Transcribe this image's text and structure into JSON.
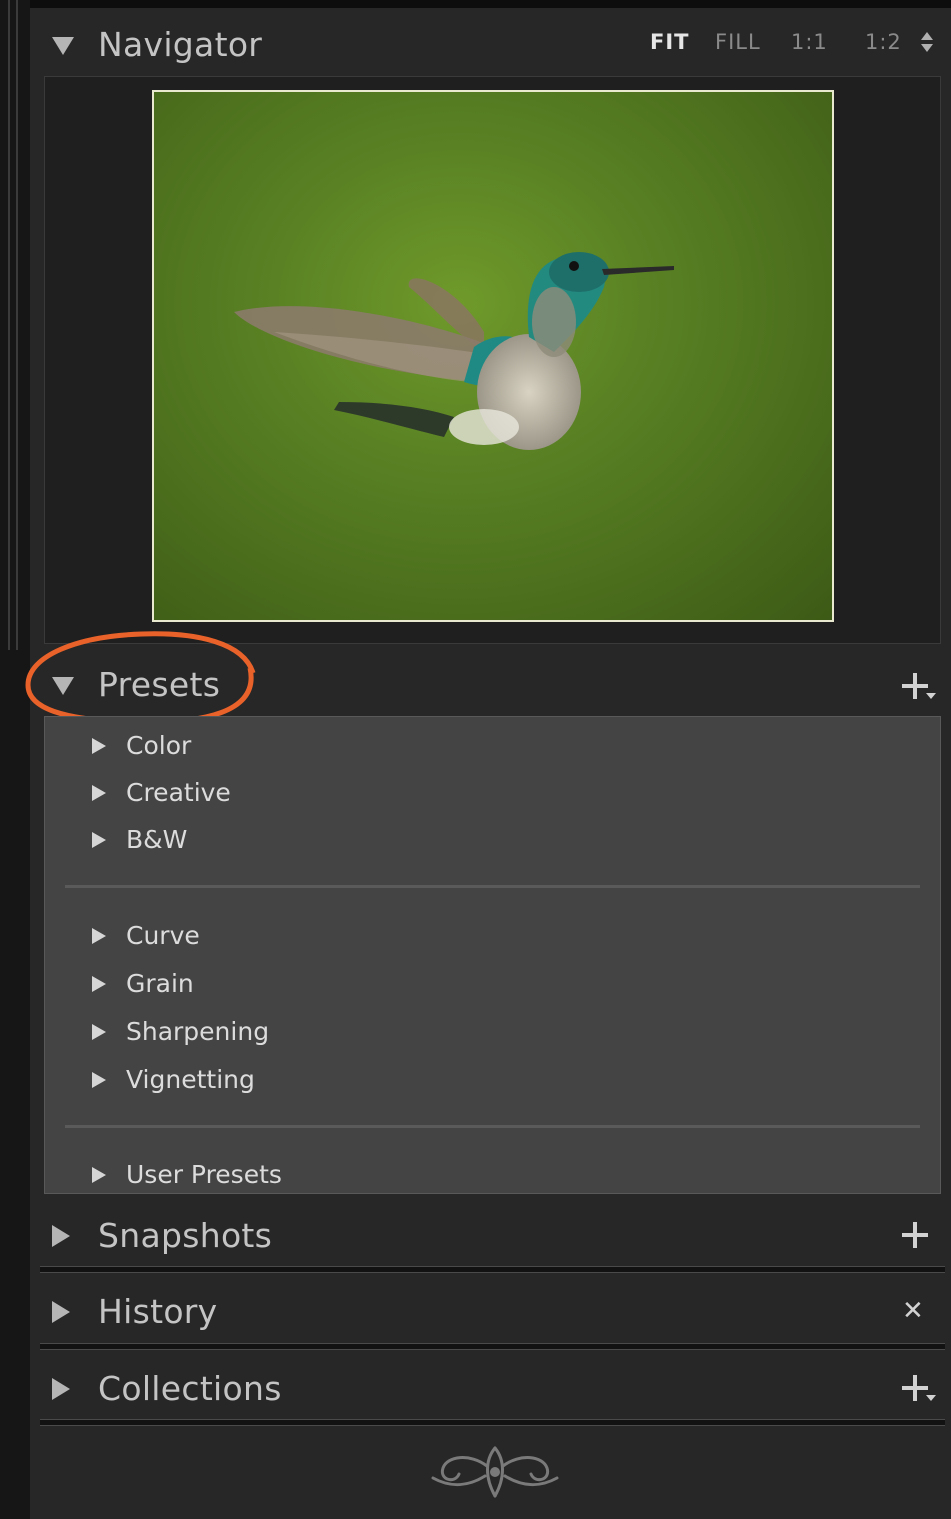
{
  "navigator": {
    "title": "Navigator",
    "zoom_options": [
      "FIT",
      "FILL",
      "1:1",
      "1:2"
    ],
    "active_zoom": "FIT"
  },
  "presets": {
    "title": "Presets",
    "groups": [
      [
        "Color",
        "Creative",
        "B&W"
      ],
      [
        "Curve",
        "Grain",
        "Sharpening",
        "Vignetting"
      ],
      [
        "User Presets"
      ]
    ],
    "highlight_color": "#e8622a"
  },
  "snapshots": {
    "title": "Snapshots"
  },
  "history": {
    "title": "History"
  },
  "collections": {
    "title": "Collections"
  },
  "icons": {
    "expanded": "triangle-down-icon",
    "collapsed": "triangle-right-icon",
    "add": "plus-icon",
    "clear": "close-icon",
    "ornament": "panel-end-ornament-icon"
  }
}
